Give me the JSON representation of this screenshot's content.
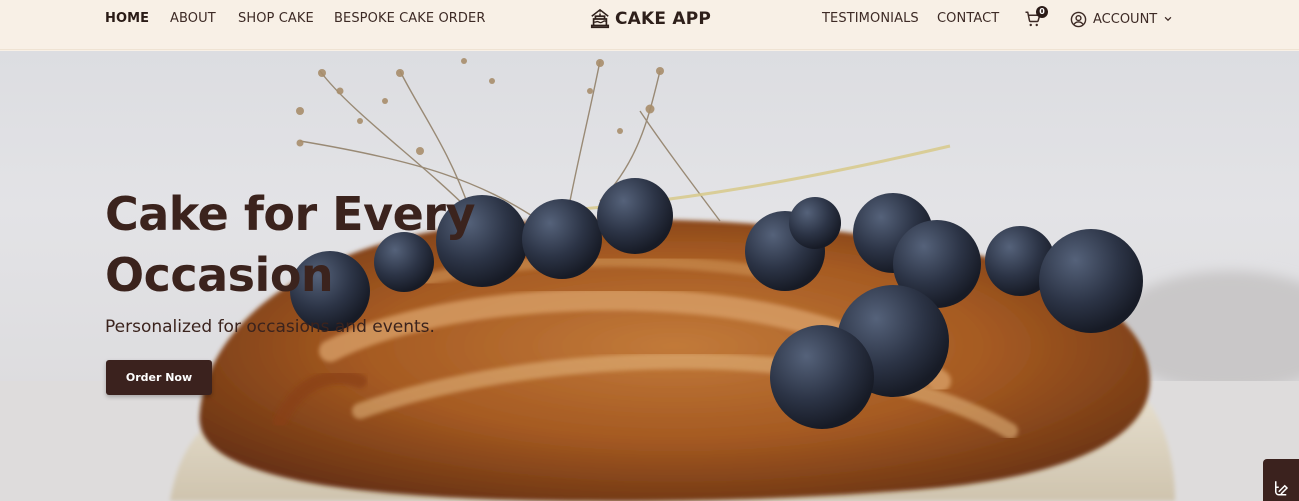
{
  "nav": {
    "left_links": [
      "HOME",
      "ABOUT",
      "SHOP CAKE",
      "BESPOKE CAKE ORDER"
    ],
    "brand": "CAKE APP",
    "right_links": [
      "TESTIMONIALS",
      "CONTACT"
    ],
    "cart_count": "0",
    "account_label": "ACCOUNT"
  },
  "hero": {
    "title_line1": "Cake for Every",
    "title_line2": "Occasion",
    "subtitle": "Personalized for occasions and events.",
    "cta": "Order Now"
  },
  "colors": {
    "nav_bg": "#f8f0e6",
    "brand_dark": "#3b221e",
    "text_dark": "#3d2a25"
  },
  "icons": [
    "cake-logo-icon",
    "cart-icon",
    "user-circle-icon",
    "chevron-down-icon",
    "accessibility-widget-icon"
  ]
}
